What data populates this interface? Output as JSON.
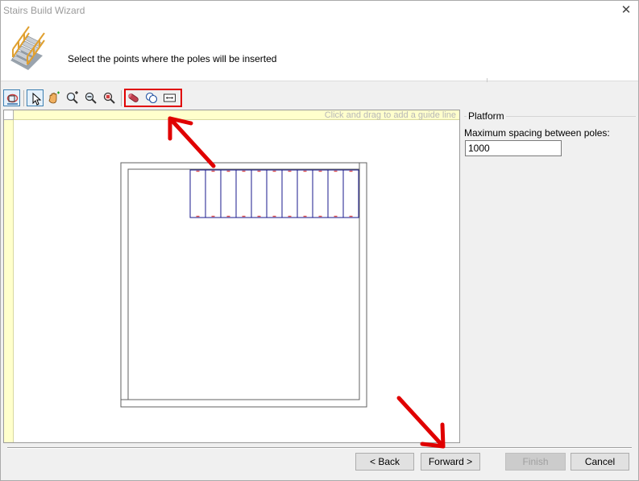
{
  "window": {
    "title": "Stairs Build Wizard",
    "close_symbol": "✕"
  },
  "header": {
    "instruction": "Select the points where the poles will be inserted",
    "icon": "stairs-icon"
  },
  "toolbar": {
    "tools": [
      {
        "name": "select-region-icon"
      },
      {
        "name": "pointer-icon"
      },
      {
        "name": "pan-hand-icon"
      },
      {
        "name": "zoom-in-icon"
      },
      {
        "name": "zoom-out-icon"
      },
      {
        "name": "zoom-extents-icon"
      },
      {
        "name": "pole-icon"
      },
      {
        "name": "circles-icon"
      },
      {
        "name": "spacing-icon"
      }
    ]
  },
  "canvas": {
    "guide_hint": "Click and drag to add a guide line",
    "step_count": 11
  },
  "panel": {
    "group_title": "Platform",
    "spacing_label": "Maximum spacing between poles:",
    "spacing_value": "1000"
  },
  "buttons": {
    "back": "< Back",
    "forward": "Forward >",
    "finish": "Finish",
    "cancel": "Cancel"
  },
  "colors": {
    "drawing_outline": "#606060",
    "steps_stroke": "#1a1a8c",
    "pole_marker": "#e05050",
    "annotation": "#e00000",
    "ruler": "#ffffcc"
  }
}
